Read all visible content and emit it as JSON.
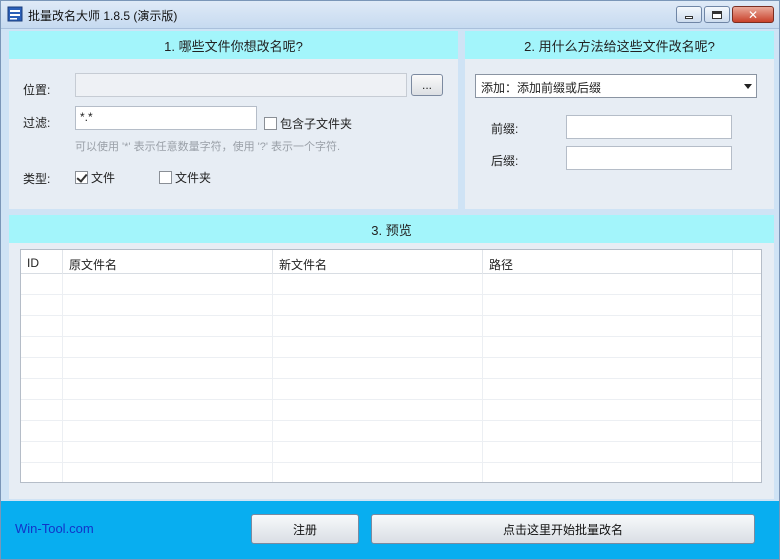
{
  "window": {
    "title": "批量改名大师 1.8.5 (演示版)"
  },
  "panel1": {
    "header": "1. 哪些文件你想改名呢?",
    "location_label": "位置:",
    "location_value": "",
    "browse_label": "...",
    "filter_label": "过滤:",
    "filter_value": "*.*",
    "include_sub_label": "包含子文件夹",
    "include_sub_checked": false,
    "hint": "可以使用 '*' 表示任意数量字符，使用 '?' 表示一个字符.",
    "type_label": "类型:",
    "type_file_label": "文件",
    "type_file_checked": true,
    "type_folder_label": "文件夹",
    "type_folder_checked": false
  },
  "panel2": {
    "header": "2. 用什么方法给这些文件改名呢?",
    "method_selected": "添加：添加前缀或后缀",
    "prefix_label": "前缀:",
    "prefix_value": "",
    "suffix_label": "后缀:",
    "suffix_value": ""
  },
  "panel3": {
    "header": "3. 预览",
    "columns": [
      "ID",
      "原文件名",
      "新文件名",
      "路径"
    ]
  },
  "footer": {
    "brand": "Win-Tool.com",
    "register_label": "注册",
    "start_label": "点击这里开始批量改名"
  },
  "colors": {
    "header_bg": "#a3f5fb",
    "footer_bg": "#08aef0",
    "brand_text": "#1234c8"
  }
}
